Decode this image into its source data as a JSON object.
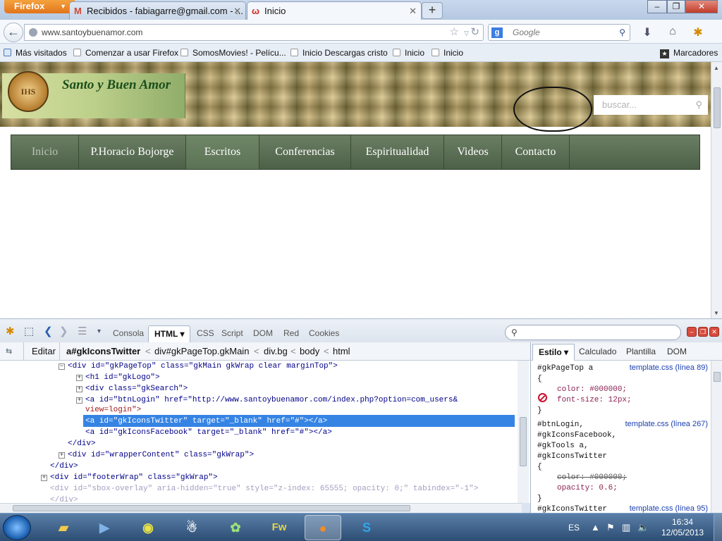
{
  "browser": {
    "menu_button": "Firefox",
    "tabs": [
      {
        "label": "Recibidos - fabiagarre@gmail.com - ...",
        "icon": "gmail-icon"
      },
      {
        "label": "Inicio",
        "icon": "site-favicon"
      }
    ],
    "new_tab": "+",
    "window_controls": [
      "–",
      "❐",
      "✕"
    ],
    "url": "www.santoybuenamor.com",
    "search_placeholder": "Google",
    "bookmarks": [
      "Más visitados",
      "Comenzar a usar Firefox",
      "SomosMovies! - Pelícu...",
      "Inicio Descargas cristo",
      "Inicio",
      "Inicio"
    ],
    "bookmarks_menu": "Marcadores"
  },
  "site": {
    "seal_text": "IHS",
    "name": "Santo y Buen Amor",
    "search_placeholder": "buscar...",
    "menu": [
      "Inicio",
      "P.Horacio Bojorge",
      "Escritos",
      "Conferencias",
      "Espiritualidad",
      "Videos",
      "Contacto"
    ]
  },
  "firebug": {
    "tabs": [
      "Consola",
      "HTML ▾",
      "CSS",
      "Script",
      "DOM",
      "Red",
      "Cookies"
    ],
    "edit_label": "Editar",
    "breadcrumb": [
      "a#gkIconsTwitter",
      "div#gkPageTop.gkMain",
      "div.bg",
      "body",
      "html"
    ],
    "side_tabs": [
      "Estilo ▾",
      "Calculado",
      "Plantilla",
      "DOM"
    ],
    "html_lines": [
      "<div id=\"gkPageTop\" class=\"gkMain gkWrap clear marginTop\">",
      "<h1 id=\"gkLogo\">",
      "<div class=\"gkSearch\">",
      "<a id=\"btnLogin\" href=\"http://www.santoybuenamor.com/index.php?option=com_users&",
      "view=login\">",
      "<a id=\"gkIconsTwitter\" target=\"_blank\" href=\"#\"></a>",
      "<a id=\"gkIconsFacebook\" target=\"_blank\" href=\"#\"></a>",
      "</div>",
      "<div id=\"wrapperContent\" class=\"gkWrap\">",
      "</div>",
      "<div id=\"footerWrap\" class=\"gkWrap\">",
      "<div id=\"sbox-overlay\" aria-hidden=\"true\" style=\"z-index: 65555; opacity: 0;\" tabindex=\"-1\">",
      "</div>"
    ],
    "css_rules": [
      {
        "selector": "#gkPageTop a",
        "source": "template.css (línea 89)"
      },
      {
        "selector": "#btnLogin,",
        "source": "template.css (línea 267)"
      },
      {
        "selector": "#gkIconsTwitter",
        "source": "template.css (línea 95)"
      }
    ],
    "css_lines": [
      "{",
      "color: #000000;",
      "font-size: 12px;",
      "}",
      "#gkIconsFacebook,",
      "#gkTools a,",
      "#gkIconsTwitter",
      "{",
      "color: #000000;",
      "opacity: 0.6;",
      "}"
    ]
  },
  "taskbar": {
    "language": "ES",
    "time": "16:34",
    "date": "12/05/2013"
  }
}
